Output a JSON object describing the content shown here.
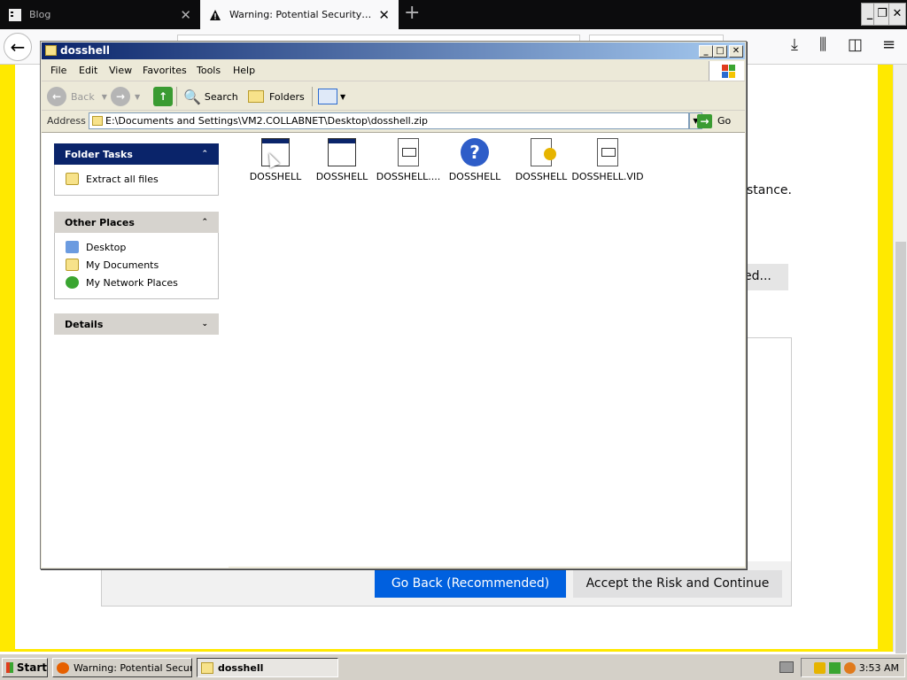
{
  "firefox": {
    "tabs": [
      {
        "title": "Blog",
        "active": false
      },
      {
        "title": "Warning: Potential Security Risk Ahead",
        "active": true
      }
    ],
    "page_fragments": {
      "visible_text_right": "stance.",
      "advanced_button_fragment": "ed..."
    },
    "buttons": {
      "go_back": "Go Back (Recommended)",
      "accept": "Accept the Risk and Continue"
    },
    "colors": {
      "accent_border": "#ffe900",
      "primary_button": "#0060df"
    }
  },
  "explorer": {
    "title": "dosshell",
    "menu": [
      "File",
      "Edit",
      "View",
      "Favorites",
      "Tools",
      "Help"
    ],
    "toolbar": {
      "back": "Back",
      "search": "Search",
      "folders": "Folders"
    },
    "address": {
      "label": "Address",
      "value": "E:\\Documents and Settings\\VM2.COLLABNET\\Desktop\\dosshell.zip",
      "go": "Go"
    },
    "panels": {
      "folder_tasks": {
        "title": "Folder Tasks",
        "items": [
          "Extract all files"
        ]
      },
      "other_places": {
        "title": "Other Places",
        "items": [
          "Desktop",
          "My Documents",
          "My Network Places"
        ]
      },
      "details": {
        "title": "Details"
      }
    },
    "files": [
      {
        "name": "DOSSHELL",
        "icon": "window-icon"
      },
      {
        "name": "DOSSHELL",
        "icon": "window-icon"
      },
      {
        "name": "DOSSHELL....",
        "icon": "document-icon"
      },
      {
        "name": "DOSSHELL",
        "icon": "help-icon"
      },
      {
        "name": "DOSSHELL",
        "icon": "config-icon"
      },
      {
        "name": "DOSSHELL.VID",
        "icon": "document-icon"
      }
    ]
  },
  "taskbar": {
    "start": "Start",
    "tasks": [
      {
        "label": "Warning: Potential Secur...",
        "active": false
      },
      {
        "label": "dosshell",
        "active": true
      }
    ],
    "clock": "3:53 AM"
  }
}
